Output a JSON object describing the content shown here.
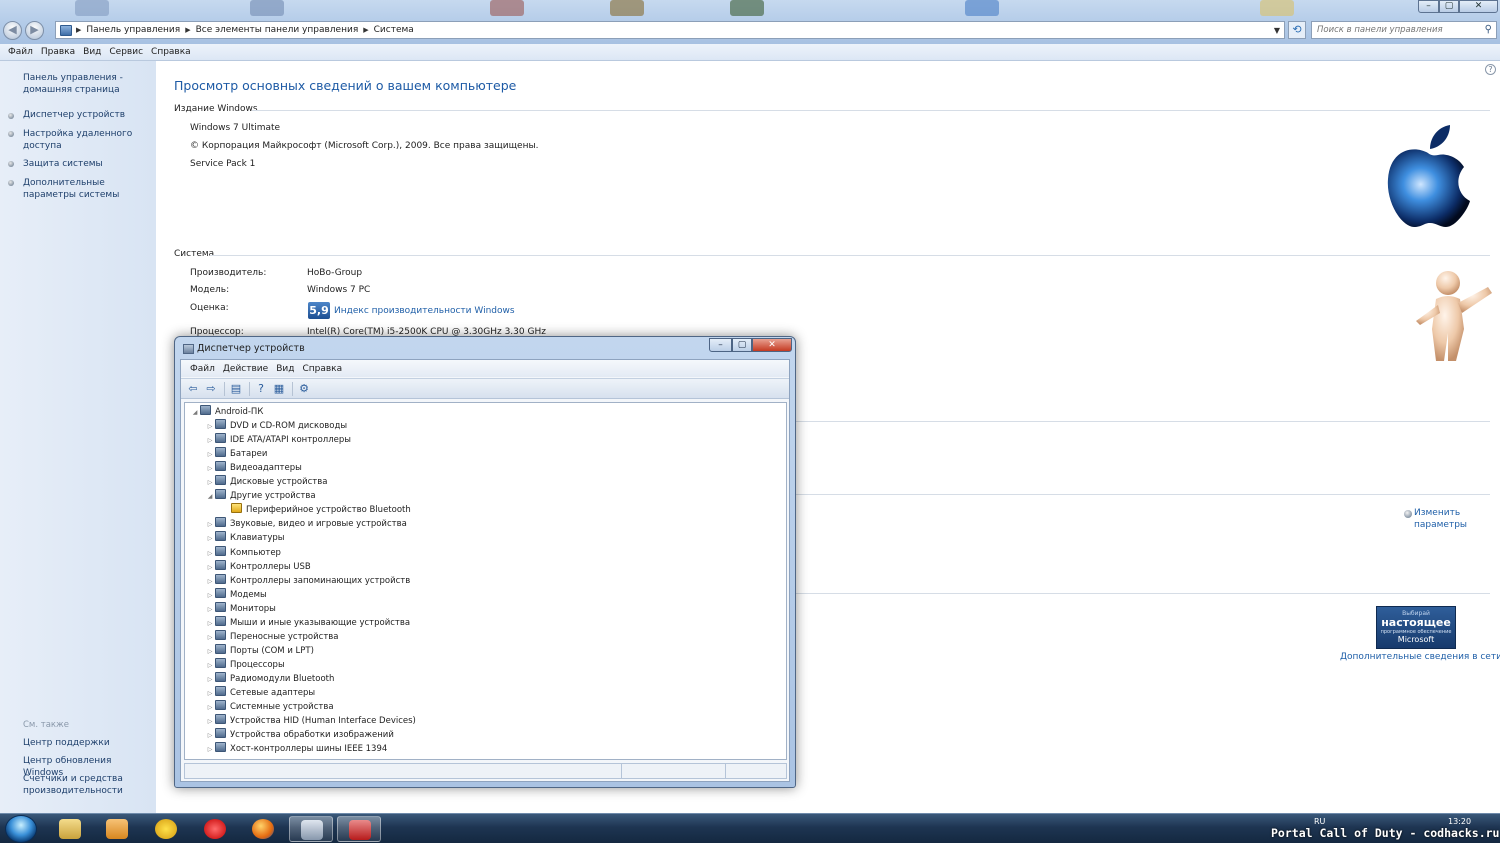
{
  "explorer": {
    "breadcrumbs": [
      "Панель управления",
      "Все элементы панели управления",
      "Система"
    ],
    "search_placeholder": "Поиск в панели управления",
    "menu": [
      "Файл",
      "Правка",
      "Вид",
      "Сервис",
      "Справка"
    ],
    "caption_buttons": [
      "–",
      "▢",
      "✕"
    ]
  },
  "left_pane": {
    "home_link": "Панель управления - домашняя страница",
    "tasks": [
      "Диспетчер устройств",
      "Настройка удаленного доступа",
      "Защита системы",
      "Дополнительные параметры системы"
    ],
    "see_also_title": "См. также",
    "see_also": [
      "Центр поддержки",
      "Центр обновления Windows",
      "Счетчики и средства производительности"
    ]
  },
  "main": {
    "title": "Просмотр основных сведений о вашем компьютере",
    "windows_edition": {
      "heading": "Издание Windows",
      "edition": "Windows 7 Ultimate",
      "copyright": "© Корпорация Майкрософт (Microsoft Corp.), 2009. Все права защищены.",
      "service_pack": "Service Pack 1"
    },
    "system": {
      "heading": "Система",
      "manufacturer_label": "Производитель:",
      "manufacturer_value": "HoBo-Group",
      "model_label": "Модель:",
      "model_value": "Windows 7 PC",
      "rating_label": "Оценка:",
      "rating_value": "5,9",
      "rating_link": "Индекс производительности Windows",
      "processor_label": "Процессор:",
      "processor_value": "Intel(R) Core(TM) i5-2500K CPU @ 3.30GHz   3.30 GHz"
    },
    "change_settings": "Изменить параметры",
    "genuine": {
      "line1": "Выбирай",
      "line2": "настоящее",
      "line3": "программное обеспечение",
      "line4": "Microsoft"
    },
    "more_info_link": "Дополнительные сведения в сети..."
  },
  "device_manager": {
    "title": "Диспетчер устройств",
    "menu": [
      "Файл",
      "Действие",
      "Вид",
      "Справка"
    ],
    "root": "Android-ПК",
    "categories": [
      "DVD и CD-ROM дисководы",
      "IDE ATA/ATAPI контроллеры",
      "Батареи",
      "Видеоадаптеры",
      "Дисковые устройства",
      "Другие устройства",
      "Звуковые, видео и игровые устройства",
      "Клавиатуры",
      "Компьютер",
      "Контроллеры USB",
      "Контроллеры запоминающих устройств",
      "Модемы",
      "Мониторы",
      "Мыши и иные указывающие устройства",
      "Переносные устройства",
      "Порты (COM и LPT)",
      "Процессоры",
      "Радиомодули Bluetooth",
      "Сетевые адаптеры",
      "Системные устройства",
      "Устройства HID (Human Interface Devices)",
      "Устройства обработки изображений",
      "Хост-контроллеры шины IEEE 1394"
    ],
    "expanded_index": 5,
    "expanded_child": "Периферийное устройство Bluetooth",
    "caption_buttons": [
      "–",
      "▢",
      "✕"
    ]
  },
  "taskbar": {
    "language": "RU",
    "time": "13:20",
    "watermark": "Portal Call of Duty - codhacks.ru"
  },
  "colors": {
    "link": "#1f5fa8",
    "title_blue": "#1d5aa5",
    "taskbar": "#1e3552"
  }
}
